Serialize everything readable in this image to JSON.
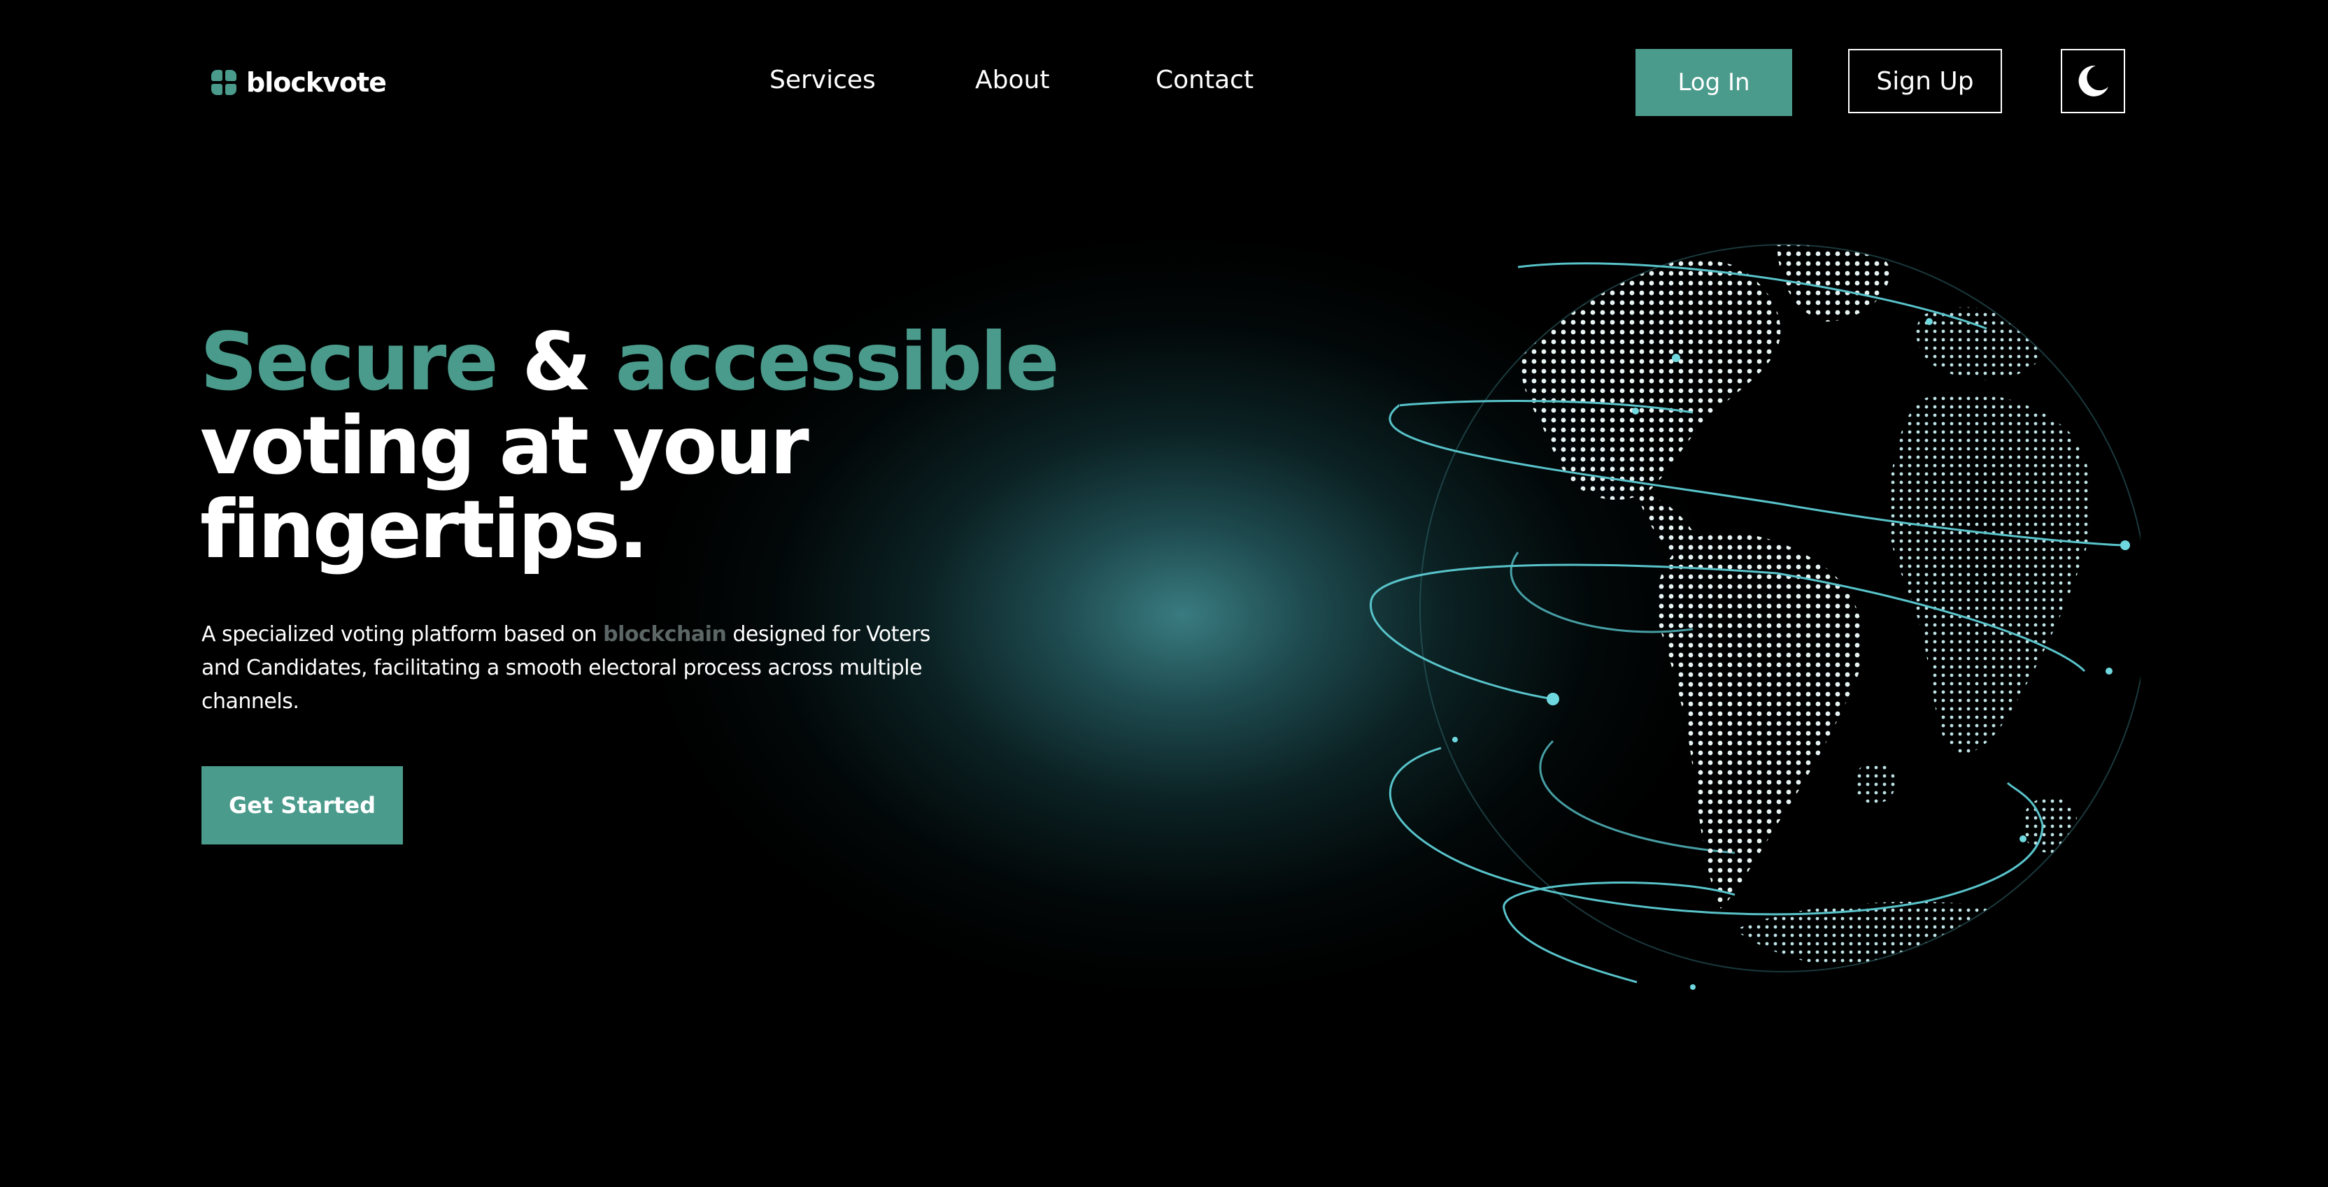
{
  "brand": {
    "name": "blockvote",
    "accent_color": "#4a9b8c",
    "logo_icon": "grid-logo-icon"
  },
  "nav": {
    "links": [
      "Services",
      "About",
      "Contact"
    ],
    "login_label": "Log In",
    "signup_label": "Sign Up",
    "theme_icon": "moon-icon"
  },
  "hero": {
    "title_line1_part1": "Secure",
    "title_line1_part2": " & ",
    "title_line1_part3": "accessible",
    "title_line2": "voting at your",
    "title_line3": "fingertips.",
    "desc_before": "A specialized voting platform based on ",
    "desc_highlight": "blockchain",
    "desc_after": " designed for Voters and Candidates, facilitating a smooth electoral process across multiple channels.",
    "cta_label": "Get Started",
    "illustration_icon": "globe-icon"
  }
}
